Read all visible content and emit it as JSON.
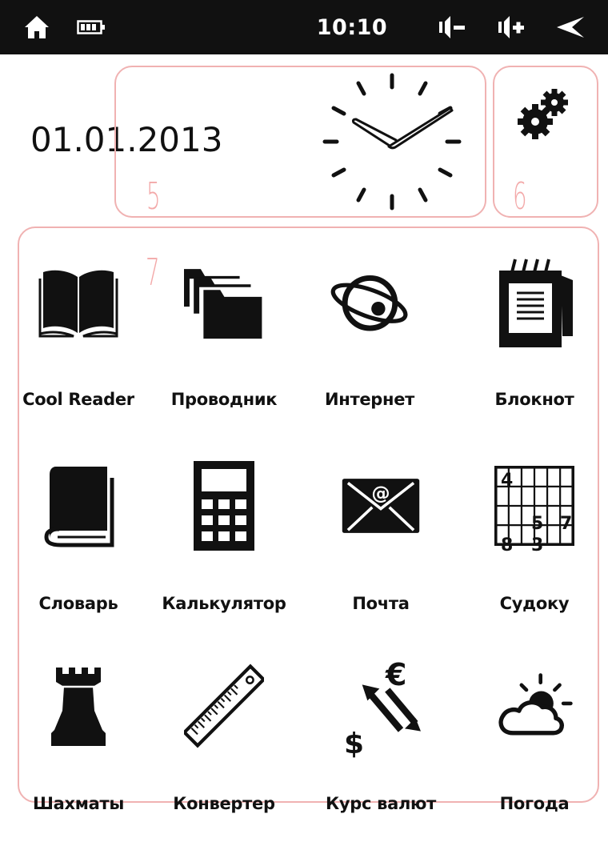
{
  "status_bar": {
    "time": "10:10",
    "icons": [
      "home-icon",
      "battery-icon",
      "volume-down-icon",
      "volume-up-icon",
      "back-icon"
    ]
  },
  "widgets": {
    "date": "01.01.2013",
    "clock_time": "10:10",
    "settings_icon": "gears-icon"
  },
  "zones": {
    "clock_zone_number": "5",
    "settings_zone_number": "6",
    "apps_zone_number": "7",
    "color": "#f0b2b2"
  },
  "apps": [
    {
      "label": "Cool Reader",
      "icon": "book-icon"
    },
    {
      "label": "Проводник",
      "icon": "folders-icon"
    },
    {
      "label": "Интернет",
      "icon": "globe-orbit-icon"
    },
    {
      "label": "Блокнот",
      "icon": "notepad-icon"
    },
    {
      "label": "Словарь",
      "icon": "dictionary-icon"
    },
    {
      "label": "Калькулятор",
      "icon": "calculator-icon"
    },
    {
      "label": "Почта",
      "icon": "mail-icon"
    },
    {
      "label": "Судоку",
      "icon": "sudoku-icon",
      "cells": [
        "4",
        "5",
        "7",
        "8",
        "3"
      ]
    },
    {
      "label": "Шахматы",
      "icon": "chess-rook-icon"
    },
    {
      "label": "Конвертер",
      "icon": "ruler-icon"
    },
    {
      "label": "Курс валют",
      "icon": "currency-exchange-icon",
      "symbols": [
        "€",
        "$"
      ]
    },
    {
      "label": "Погода",
      "icon": "weather-icon"
    }
  ]
}
